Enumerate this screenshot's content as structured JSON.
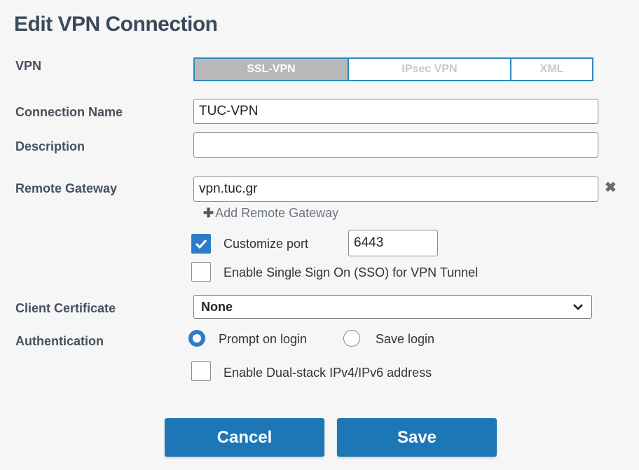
{
  "dialog": {
    "title": "Edit VPN Connection"
  },
  "vpn": {
    "label": "VPN",
    "tabs": [
      "SSL-VPN",
      "IPsec VPN",
      "XML"
    ],
    "active": "SSL-VPN"
  },
  "connection_name": {
    "label": "Connection Name",
    "value": "TUC-VPN"
  },
  "description": {
    "label": "Description",
    "value": ""
  },
  "remote_gateway": {
    "label": "Remote Gateway",
    "value": "vpn.tuc.gr",
    "add_label": "Add Remote Gateway"
  },
  "customize_port": {
    "label": "Customize port",
    "checked": true,
    "port": "6443"
  },
  "sso": {
    "label": "Enable Single Sign On (SSO) for VPN Tunnel",
    "checked": false
  },
  "client_certificate": {
    "label": "Client Certificate",
    "selected": "None"
  },
  "authentication": {
    "label": "Authentication",
    "options": [
      "Prompt on login",
      "Save login"
    ],
    "selected": "Prompt on login"
  },
  "dual_stack": {
    "label": "Enable Dual-stack IPv4/IPv6 address",
    "checked": false
  },
  "buttons": {
    "cancel": "Cancel",
    "save": "Save"
  },
  "colors": {
    "accent": "#1d77b6",
    "tab_border": "#2d8bbf",
    "active_tab": "#b8b8b8"
  }
}
